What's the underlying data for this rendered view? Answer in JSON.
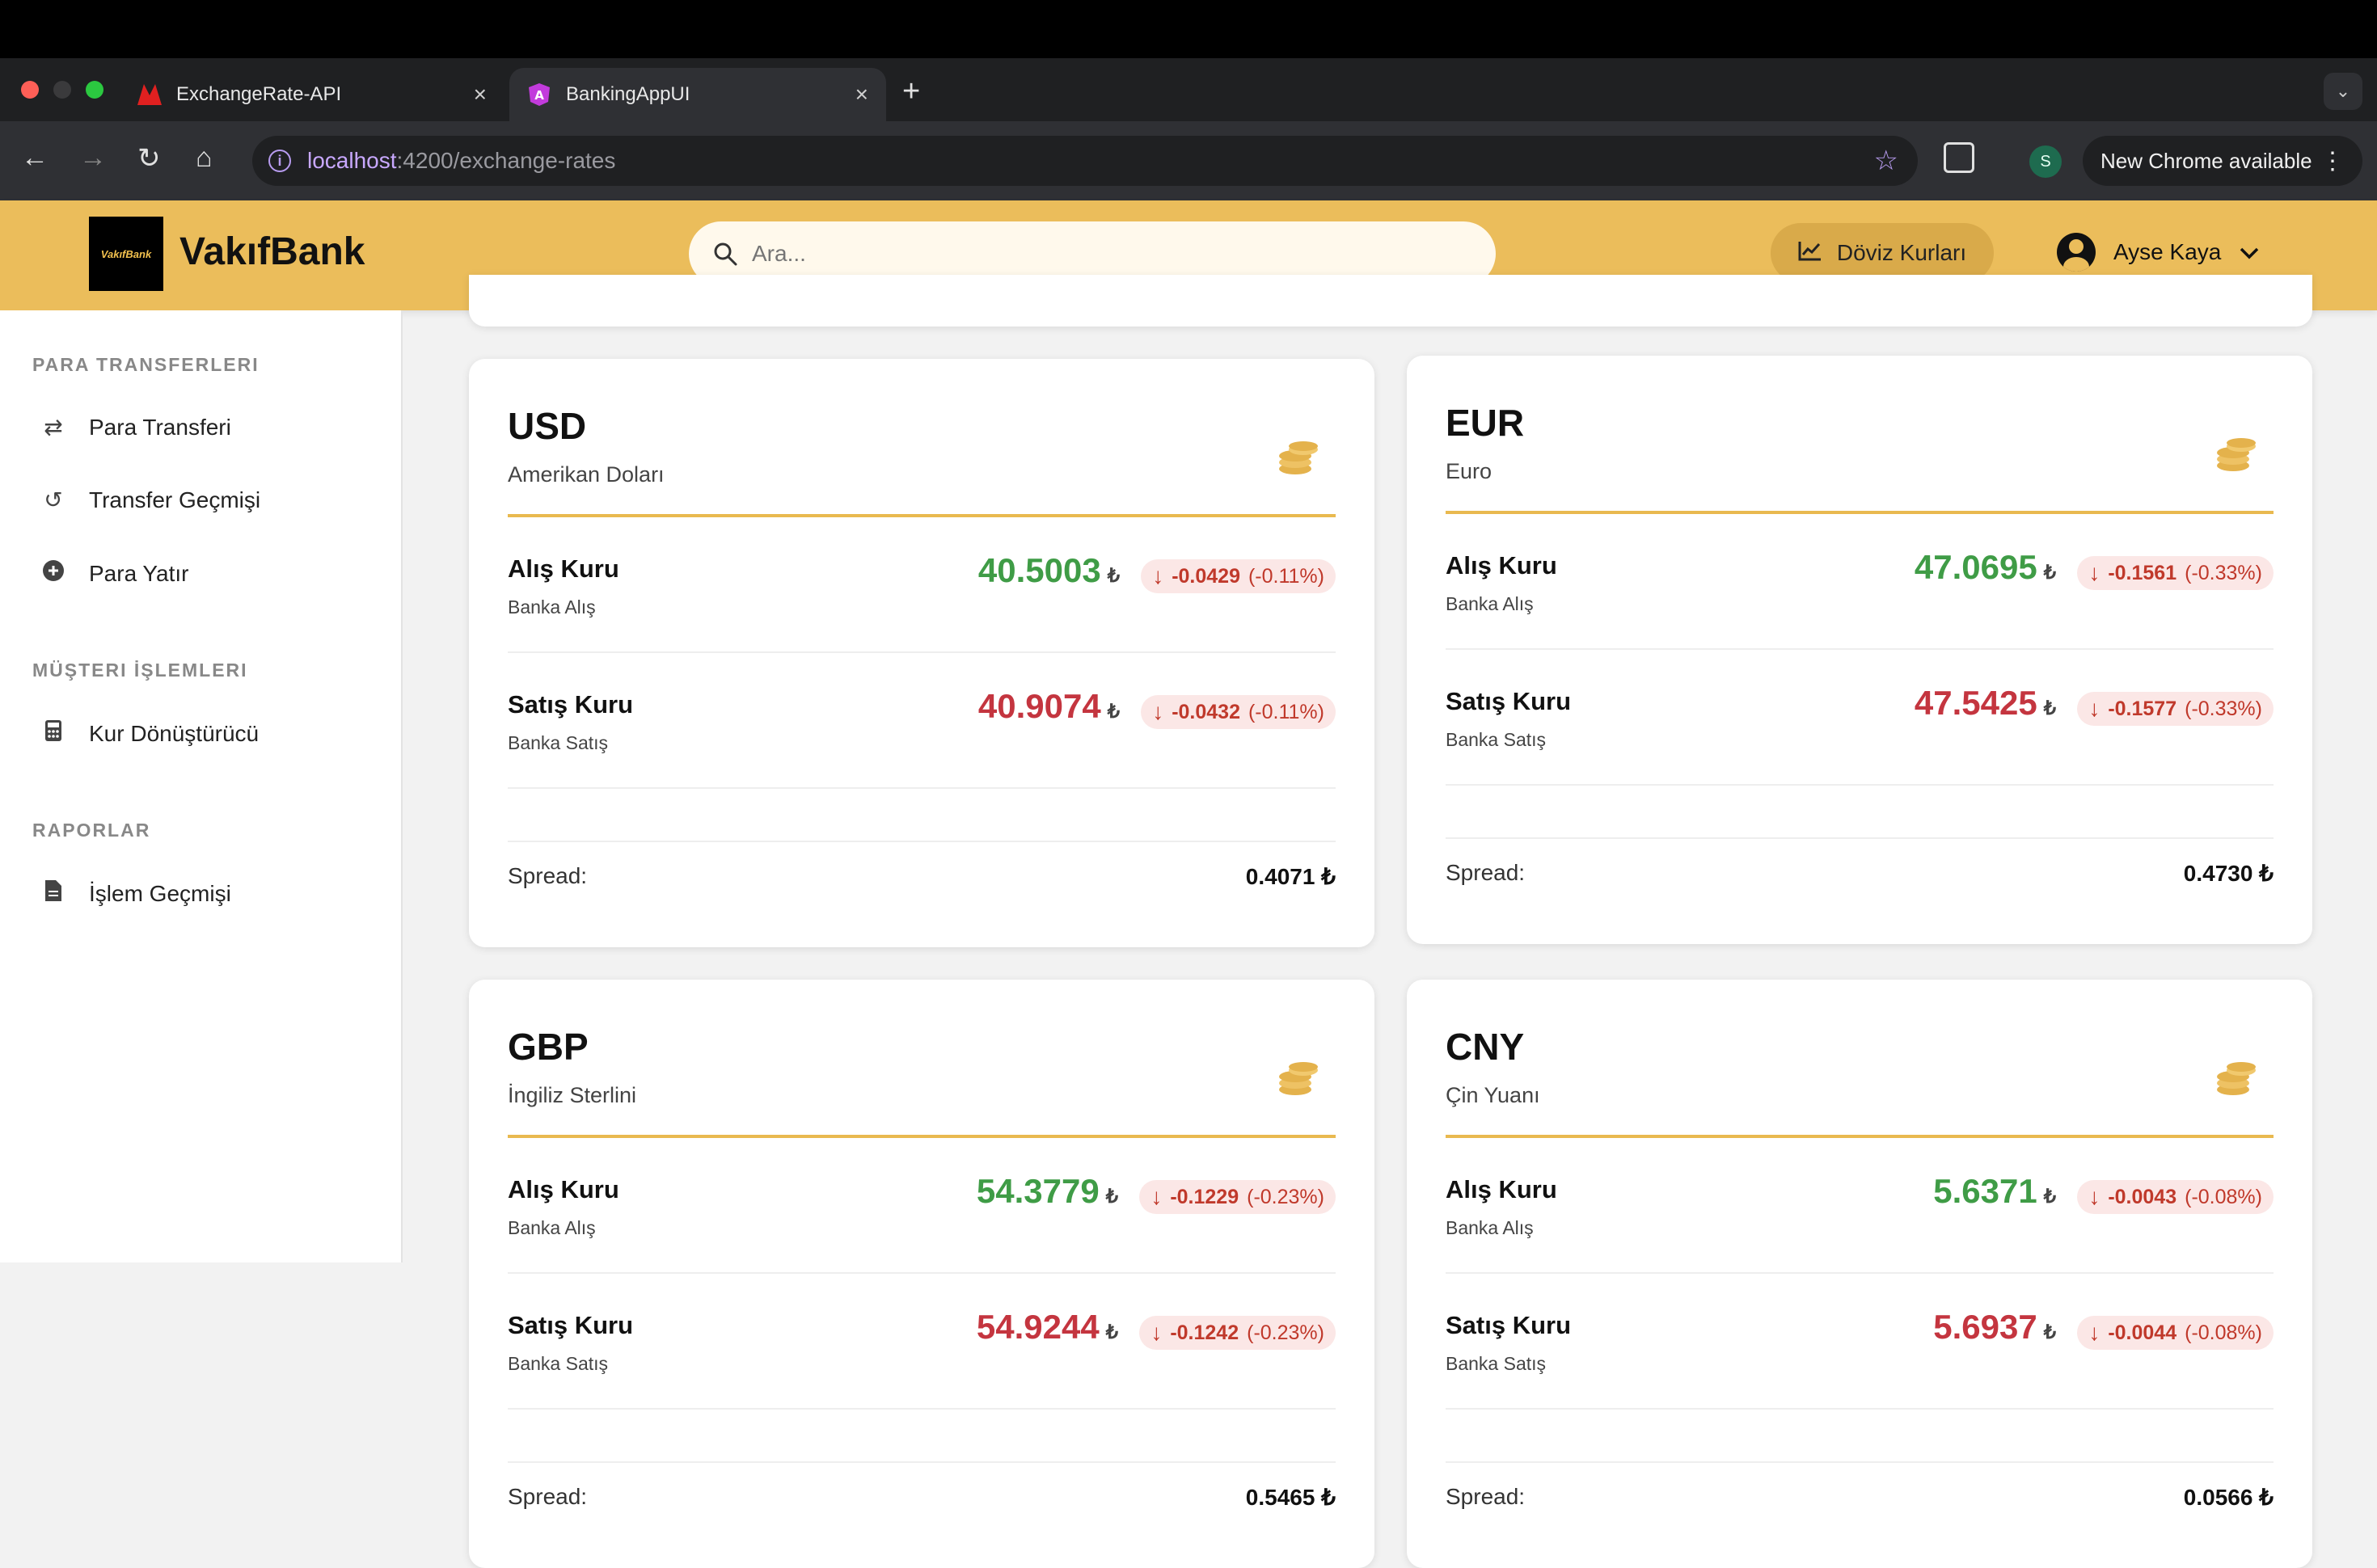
{
  "browser": {
    "tabs": [
      {
        "title": "ExchangeRate-API",
        "close": "×"
      },
      {
        "title": "BankingAppUI",
        "close": "×"
      }
    ],
    "new_tab": "+",
    "url_host": "localhost",
    "url_path": ":4200/exchange-rates",
    "profile_initial": "S",
    "update_label": "New Chrome available"
  },
  "header": {
    "logo_text": "VakıfBank",
    "brand": "VakıfBank",
    "search_placeholder": "Ara...",
    "rates_button": "Döviz Kurları",
    "user_name": "Ayse Kaya"
  },
  "sidebar": {
    "sections": [
      {
        "title": "PARA TRANSFERLERI",
        "items": [
          {
            "label": "Para Transferi",
            "icon": "transfer-arrows-icon"
          },
          {
            "label": "Transfer Geçmişi",
            "icon": "history-icon"
          },
          {
            "label": "Para Yatır",
            "icon": "plus-circle-icon"
          }
        ]
      },
      {
        "title": "MÜŞTERI İŞLEMLERI",
        "items": [
          {
            "label": "Kur Dönüştürücü",
            "icon": "calculator-icon"
          }
        ]
      },
      {
        "title": "RAPORLAR",
        "items": [
          {
            "label": "İşlem Geçmişi",
            "icon": "document-icon"
          }
        ]
      }
    ]
  },
  "labels": {
    "buy": "Alış Kuru",
    "buy_sub": "Banka Alış",
    "sell": "Satış Kuru",
    "sell_sub": "Banka Satış",
    "spread": "Spread:",
    "currency_symbol": "₺"
  },
  "currencies": [
    {
      "code": "USD",
      "name": "Amerikan Doları",
      "buy": "40.5003",
      "buy_change": "-0.0429",
      "buy_pct": "(-0.11%)",
      "sell": "40.9074",
      "sell_change": "-0.0432",
      "sell_pct": "(-0.11%)",
      "spread": "0.4071 ₺"
    },
    {
      "code": "EUR",
      "name": "Euro",
      "buy": "47.0695",
      "buy_change": "-0.1561",
      "buy_pct": "(-0.33%)",
      "sell": "47.5425",
      "sell_change": "-0.1577",
      "sell_pct": "(-0.33%)",
      "spread": "0.4730 ₺"
    },
    {
      "code": "GBP",
      "name": "İngiliz Sterlini",
      "buy": "54.3779",
      "buy_change": "-0.1229",
      "buy_pct": "(-0.23%)",
      "sell": "54.9244",
      "sell_change": "-0.1242",
      "sell_pct": "(-0.23%)",
      "spread": "0.5465 ₺"
    },
    {
      "code": "CNY",
      "name": "Çin Yuanı",
      "buy": "5.6371",
      "buy_change": "-0.0043",
      "buy_pct": "(-0.08%)",
      "sell": "5.6937",
      "sell_change": "-0.0044",
      "sell_pct": "(-0.08%)",
      "spread": "0.0566 ₺"
    }
  ],
  "colors": {
    "brand": "#ebbd5b",
    "buy": "#3f9c46",
    "sell": "#c4353f",
    "change_bg": "#fbe7e6"
  }
}
